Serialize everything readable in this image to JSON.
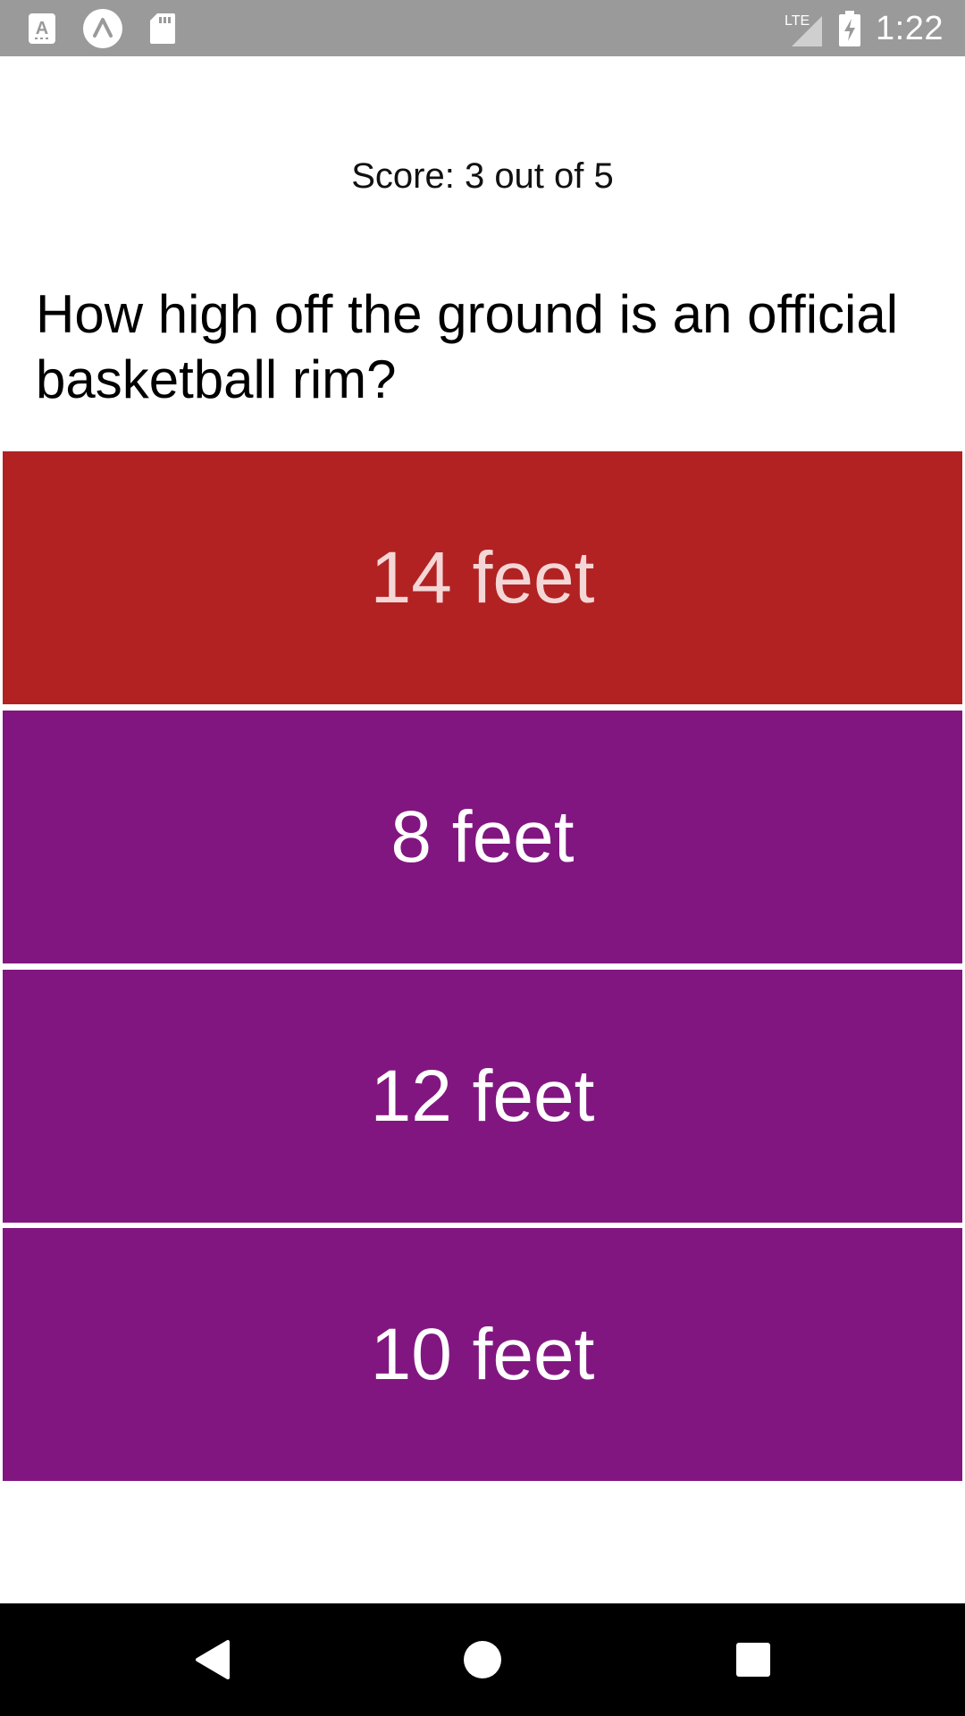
{
  "status_bar": {
    "time": "1:22",
    "network": "LTE",
    "left_icons": [
      "text-a-icon",
      "expo-icon",
      "sd-card-icon"
    ],
    "right_icons": [
      "lte-signal-icon",
      "battery-charging-icon"
    ]
  },
  "quiz": {
    "score_text": "Score: 3 out of 5",
    "question": "How high off the ground is an official basketball rim?",
    "answers": [
      {
        "label": "14 feet",
        "state": "incorrect",
        "bg": "#b22222",
        "text_color": "#f5d6d6"
      },
      {
        "label": "8 feet",
        "state": "default",
        "bg": "#821681",
        "text_color": "#ffffff"
      },
      {
        "label": "12 feet",
        "state": "default",
        "bg": "#821681",
        "text_color": "#ffffff"
      },
      {
        "label": "10 feet",
        "state": "default",
        "bg": "#821681",
        "text_color": "#ffffff"
      }
    ]
  },
  "nav_bar": {
    "buttons": [
      "back-icon",
      "home-icon",
      "recents-icon"
    ]
  },
  "colors": {
    "status_bar_bg": "#9a9a9a",
    "nav_bar_bg": "#000000",
    "incorrect": "#b22222",
    "answer_default": "#821681"
  }
}
